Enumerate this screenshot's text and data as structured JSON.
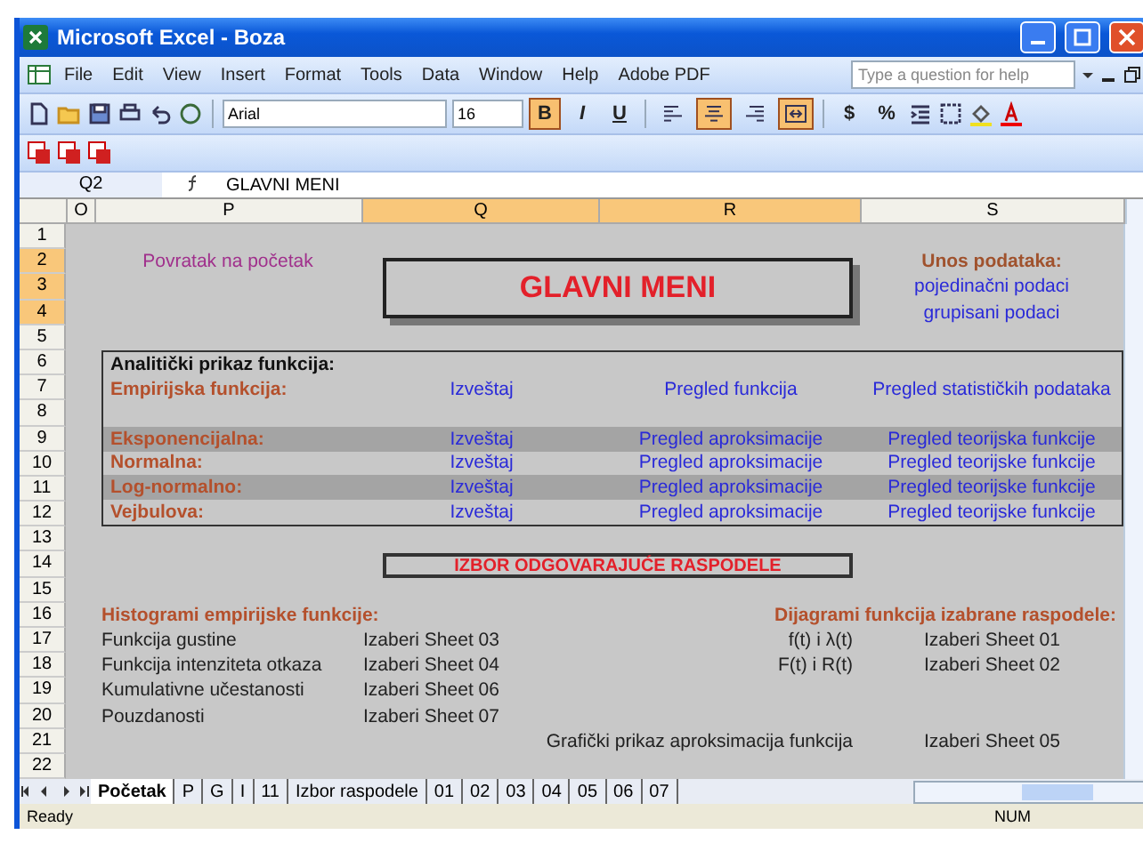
{
  "window": {
    "title": "Microsoft Excel - Boza"
  },
  "menu": [
    "File",
    "Edit",
    "View",
    "Insert",
    "Format",
    "Tools",
    "Data",
    "Window",
    "Help",
    "Adobe PDF"
  ],
  "help_search": {
    "placeholder": "Type a question for help"
  },
  "toolbar": {
    "font": "Arial",
    "size": "16",
    "styles": [
      {
        "label": "B",
        "selected": true
      },
      {
        "label": "I",
        "selected": false
      },
      {
        "label": "U",
        "selected": false
      }
    ],
    "alignment": [
      {
        "kind": "left",
        "selected": false
      },
      {
        "kind": "center",
        "selected": true
      },
      {
        "kind": "right",
        "selected": false
      },
      {
        "kind": "merge",
        "selected": true
      }
    ],
    "number": [
      "$",
      "%"
    ]
  },
  "formula_bar": {
    "name_box": "Q2",
    "formula": "GLAVNI MENI"
  },
  "columns": [
    {
      "label": "O",
      "selected": false
    },
    {
      "label": "P",
      "selected": false
    },
    {
      "label": "Q",
      "selected": true
    },
    {
      "label": "R",
      "selected": true
    },
    {
      "label": "S",
      "selected": false
    }
  ],
  "rows": [
    {
      "label": "1",
      "selected": false
    },
    {
      "label": "2",
      "selected": true
    },
    {
      "label": "3",
      "selected": true
    },
    {
      "label": "4",
      "selected": true
    },
    {
      "label": "5",
      "selected": false
    },
    {
      "label": "6",
      "selected": false
    },
    {
      "label": "7",
      "selected": false
    },
    {
      "label": "8",
      "selected": false
    },
    {
      "label": "9",
      "selected": false
    },
    {
      "label": "10",
      "selected": false
    },
    {
      "label": "11",
      "selected": false
    },
    {
      "label": "12",
      "selected": false
    },
    {
      "label": "13",
      "selected": false
    },
    {
      "label": "14",
      "selected": false
    },
    {
      "label": "15",
      "selected": false
    },
    {
      "label": "16",
      "selected": false
    },
    {
      "label": "17",
      "selected": false
    },
    {
      "label": "18",
      "selected": false
    },
    {
      "label": "19",
      "selected": false
    },
    {
      "label": "20",
      "selected": false
    },
    {
      "label": "21",
      "selected": false
    },
    {
      "label": "22",
      "selected": false
    }
  ],
  "sheet": {
    "back_link": "Povratak na početak",
    "main_title": "GLAVNI MENI",
    "data_entry": {
      "heading": "Unos podataka:",
      "links": [
        "pojedinačni podaci",
        "grupisani podaci"
      ]
    },
    "analysis": {
      "heading": "Analitički prikaz funkcija:",
      "header": {
        "label": "Empirijska funkcija:",
        "links": [
          "Izveštaj",
          "Pregled funkcija",
          "Pregled statističkih podataka"
        ]
      },
      "rows": [
        {
          "label": "Eksponencijalna:",
          "shaded": true,
          "links": [
            "Izveštaj",
            "Pregled aproksimacije",
            "Pregled teorijska funkcije"
          ]
        },
        {
          "label": "Normalna:",
          "shaded": false,
          "links": [
            "Izveštaj",
            "Pregled aproksimacije",
            "Pregled teorijske funkcije"
          ]
        },
        {
          "label": "Log-normalno:",
          "shaded": true,
          "links": [
            "Izveštaj",
            "Pregled aproksimacije",
            "Pregled teorijske funkcije"
          ]
        },
        {
          "label": "Vejbulova:",
          "shaded": false,
          "links": [
            "Izveštaj",
            "Pregled aproksimacije",
            "Pregled teorijske funkcije"
          ]
        }
      ]
    },
    "choice_button": "IZBOR ODGOVARAJUĆE RASPODELE",
    "histograms": {
      "heading": "Histogrami empirijske funkcije:",
      "items": [
        {
          "label": "Funkcija gustine",
          "link": "Izaberi Sheet 03"
        },
        {
          "label": "Funkcija intenziteta otkaza",
          "link": "Izaberi Sheet 04"
        },
        {
          "label": "Kumulativne učestanosti",
          "link": "Izaberi Sheet 06"
        },
        {
          "label": "Pouzdanosti",
          "link": "Izaberi Sheet 07"
        }
      ]
    },
    "diagrams": {
      "heading": "Dijagrami funkcija izabrane raspodele:",
      "items": [
        {
          "label": "f(t) i λ(t)",
          "link": "Izaberi Sheet 01"
        },
        {
          "label": "F(t) i R(t)",
          "link": "Izaberi Sheet 02"
        }
      ]
    },
    "graphic": {
      "label": "Grafički prikaz aproksimacija funkcija",
      "link": "Izaberi Sheet 05"
    }
  },
  "sheet_tabs": [
    {
      "label": "Početak",
      "selected": true
    },
    {
      "label": "P",
      "selected": false
    },
    {
      "label": "G",
      "selected": false
    },
    {
      "label": "I",
      "selected": false
    },
    {
      "label": "11",
      "selected": false
    },
    {
      "label": "Izbor raspodele",
      "selected": false
    },
    {
      "label": "01",
      "selected": false
    },
    {
      "label": "02",
      "selected": false
    },
    {
      "label": "03",
      "selected": false
    },
    {
      "label": "04",
      "selected": false
    },
    {
      "label": "05",
      "selected": false
    },
    {
      "label": "06",
      "selected": false
    },
    {
      "label": "07",
      "selected": false
    }
  ],
  "status_bar": {
    "mode": "Ready",
    "indicator": "NUM"
  }
}
